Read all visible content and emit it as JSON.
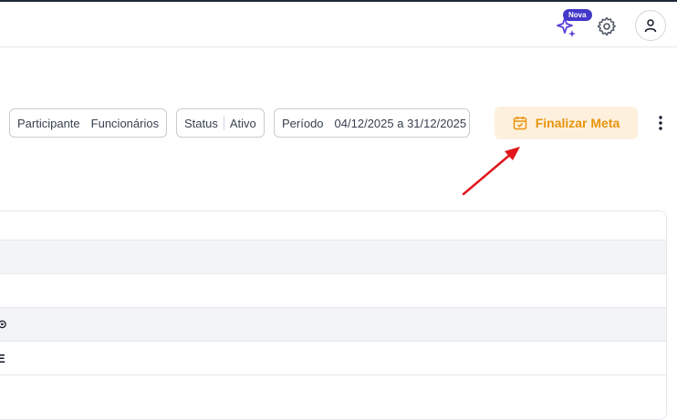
{
  "topbar": {
    "new_badge": "Nova",
    "icons": [
      "sparkle-icon",
      "gear-icon",
      "user-icon"
    ]
  },
  "filters": {
    "participante": {
      "label": "Participante",
      "value": "Funcionários"
    },
    "status": {
      "label": "Status",
      "value": "Ativo"
    },
    "periodo": {
      "label": "Período",
      "value": "04/12/2025 a 31/12/2025"
    }
  },
  "actions": {
    "finalize_label": "Finalizar Meta",
    "finalize_icon": "calendar-check-icon",
    "more_icon": "more-vertical-icon"
  },
  "annotation": {
    "arrow_color": "#e0161b"
  },
  "table": {
    "rows": [
      {
        "text": "",
        "shaded": true
      },
      {
        "text": "",
        "shaded": false
      },
      {
        "text": "⊙",
        "shaded": true
      },
      {
        "text": "E",
        "shaded": false
      },
      {
        "text": "",
        "shaded": false
      }
    ]
  },
  "colors": {
    "accent": "#e8940c",
    "accent_bg": "#fdf0dd",
    "badge": "#4338ca",
    "sparkle": "#5b3fd9"
  }
}
